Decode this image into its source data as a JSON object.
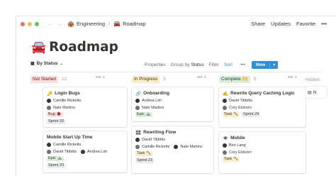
{
  "window": {
    "dots": [
      "#ed6a5e",
      "#f4bf4f",
      "#61c554"
    ],
    "breadcrumb": {
      "workspace": "Engineering",
      "page": "Roadmap",
      "separator": "/"
    },
    "actions": {
      "share": "Share",
      "updates": "Updates",
      "favorite": "Favorite",
      "more": "•••"
    }
  },
  "page": {
    "emoji": "🚘",
    "title": "Roadmap"
  },
  "toolbar": {
    "view": "By Status",
    "properties": "Properties",
    "group_prefix": "Group by",
    "group_value": "Status",
    "filter": "Filter",
    "sort": "Sort",
    "more": "•••",
    "new": "New",
    "accent": "#2e8fd3"
  },
  "columns": [
    {
      "label": "Not Started",
      "count": "12",
      "badge_bg": "#fddfe0",
      "badge_fg": "#5d1715",
      "cards": [
        {
          "emoji": "🔑",
          "title": "Login Bugs",
          "people": [
            "Camille Ricketts",
            "Nate Martins"
          ],
          "tags": [
            {
              "text": "Bug",
              "emoji": "🐞",
              "bg": "#fddfe0"
            },
            {
              "text": "Sprint 20",
              "emoji": "",
              "bg": "#ebeced"
            }
          ]
        },
        {
          "emoji": "",
          "title": "Mobile Start Up Time",
          "people": [
            "Camille Ricketts"
          ],
          "people_pair": [
            "David Tibbitts",
            "Andrea Lim"
          ],
          "tags": [
            {
              "text": "Epic",
              "emoji": "⛰️",
              "bg": "#dbeddb"
            },
            {
              "text": "Sprint 20",
              "emoji": "",
              "bg": "#ebeced"
            }
          ]
        }
      ]
    },
    {
      "label": "In Progress",
      "count": "5",
      "badge_bg": "#fdecc8",
      "badge_fg": "#402c1b",
      "cards": [
        {
          "emoji": "🔗",
          "title": "Onboarding",
          "people": [
            "Andrea Lim",
            "Nate Martins"
          ],
          "tags": [
            {
              "text": "Epic",
              "emoji": "⛰️",
              "bg": "#dbeddb"
            }
          ]
        },
        {
          "emoji": "🎛️",
          "title": "Rewriting Flow",
          "people": [
            "David Tibbitts"
          ],
          "people_pair": [
            "Camille Ricketts",
            "Nate Martins"
          ],
          "tags": [
            {
              "text": "Task",
              "emoji": "🔨",
              "bg": "#fdecc8"
            },
            {
              "text": "Sprint 23",
              "emoji": "",
              "bg": "#ebeced"
            }
          ]
        }
      ]
    },
    {
      "label": "Complete",
      "label_emoji": "🙌",
      "count": "5",
      "badge_bg": "#dbeddb",
      "badge_fg": "#1c3829",
      "cards": [
        {
          "emoji": "✍️",
          "title": "Rewrite Query Caching Logic",
          "people": [
            "David Tibbitts",
            "Cory Etzkorn"
          ],
          "tags": [
            {
              "text": "Task",
              "emoji": "🔨",
              "bg": "#fdecc8"
            },
            {
              "text": "Sprint 24",
              "emoji": "",
              "bg": "#ebeced"
            }
          ]
        },
        {
          "emoji": "👁️",
          "title": "Mobile",
          "people": [
            "Ben Lang",
            "Cory Etzkorn"
          ],
          "tags": [
            {
              "text": "Task",
              "emoji": "🔨",
              "bg": "#fdecc8"
            }
          ]
        }
      ]
    }
  ],
  "hidden": {
    "label": "Hidden",
    "card_prefix": "N"
  }
}
